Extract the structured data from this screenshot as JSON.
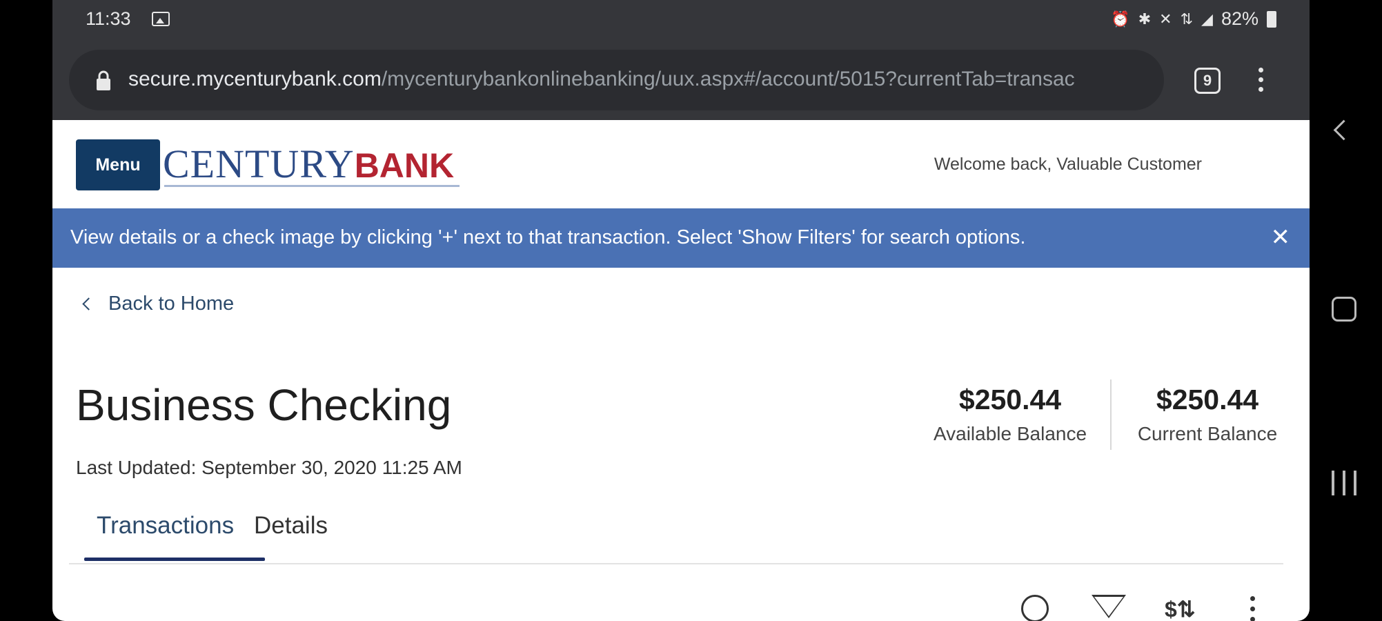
{
  "status_bar": {
    "time": "11:33",
    "battery": "82%",
    "icons": [
      "image-icon",
      "alarm-icon",
      "bluetooth-icon",
      "mute-icon",
      "data-icon",
      "signal-icon",
      "battery-icon"
    ]
  },
  "browser": {
    "url_host": "secure.mycenturybank.com",
    "url_path": "/mycenturybankonlinebanking/uux.aspx#/account/5015?currentTab=transac",
    "tab_count": "9"
  },
  "header": {
    "menu_label": "Menu",
    "logo_century": "CENTURY",
    "logo_bank": "BANK",
    "welcome": "Welcome back, Valuable Customer"
  },
  "banner": {
    "text": "View details or a check image by clicking '+' next to that transaction. Select 'Show Filters' for search options.",
    "close": "✕"
  },
  "nav": {
    "back_label": "Back to Home"
  },
  "account": {
    "title": "Business Checking",
    "last_updated": "Last Updated: September 30, 2020 11:25 AM",
    "available_balance": "$250.44",
    "available_label": "Available Balance",
    "current_balance": "$250.44",
    "current_label": "Current Balance"
  },
  "tabs": [
    {
      "label": "Transactions",
      "active": true
    },
    {
      "label": "Details",
      "active": false
    }
  ],
  "toolbar": {
    "sort_glyph": "$⇅"
  },
  "colors": {
    "brand_navy": "#123a63",
    "banner_blue": "#4a71b4",
    "bank_red": "#b32431",
    "tab_underline": "#1d2f66"
  }
}
